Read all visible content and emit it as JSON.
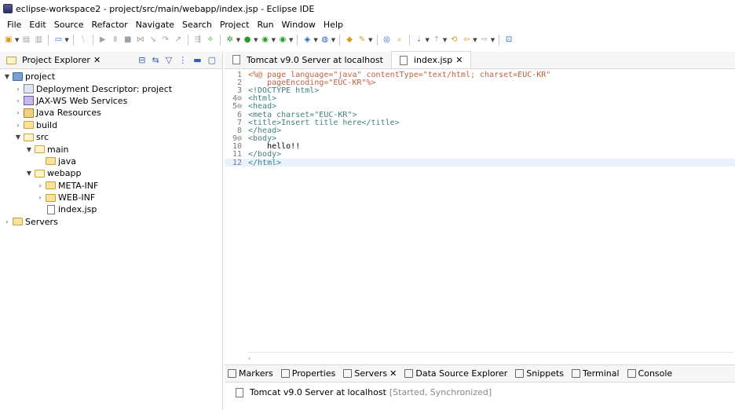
{
  "window": {
    "title": "eclipse-workspace2 - project/src/main/webapp/index.jsp - Eclipse IDE"
  },
  "menu": [
    "File",
    "Edit",
    "Source",
    "Refactor",
    "Navigate",
    "Search",
    "Project",
    "Run",
    "Window",
    "Help"
  ],
  "explorer": {
    "tab_label": "Project Explorer",
    "tree": [
      {
        "label": "project",
        "depth": 0,
        "expanded": true,
        "icon": "project-icon"
      },
      {
        "label": "Deployment Descriptor: project",
        "depth": 1,
        "expanded": false,
        "icon": "descriptor-icon"
      },
      {
        "label": "JAX-WS Web Services",
        "depth": 1,
        "expanded": false,
        "icon": "webservice-icon"
      },
      {
        "label": "Java Resources",
        "depth": 1,
        "expanded": false,
        "icon": "java-resources-icon"
      },
      {
        "label": "build",
        "depth": 1,
        "expanded": false,
        "icon": "folder-icon"
      },
      {
        "label": "src",
        "depth": 1,
        "expanded": true,
        "icon": "folder-icon"
      },
      {
        "label": "main",
        "depth": 2,
        "expanded": true,
        "icon": "folder-icon"
      },
      {
        "label": "java",
        "depth": 3,
        "expanded": null,
        "icon": "folder-icon"
      },
      {
        "label": "webapp",
        "depth": 2,
        "expanded": true,
        "icon": "folder-icon"
      },
      {
        "label": "META-INF",
        "depth": 3,
        "expanded": false,
        "icon": "folder-icon"
      },
      {
        "label": "WEB-INF",
        "depth": 3,
        "expanded": false,
        "icon": "folder-icon"
      },
      {
        "label": "index.jsp",
        "depth": 3,
        "expanded": null,
        "icon": "file-icon"
      },
      {
        "label": "Servers",
        "depth": 0,
        "expanded": false,
        "icon": "folder-icon"
      }
    ]
  },
  "editor": {
    "tabs": [
      {
        "label": "Tomcat v9.0 Server at localhost",
        "active": false
      },
      {
        "label": "index.jsp",
        "active": true
      }
    ],
    "lines": [
      {
        "n": "1",
        "text": "<%@ page language=\"java\" contentType=\"text/html; charset=EUC-KR\""
      },
      {
        "n": "2",
        "text": "    pageEncoding=\"EUC-KR\"%>"
      },
      {
        "n": "3",
        "text": "<!DOCTYPE html>"
      },
      {
        "n": "4⊖",
        "text": "<html>"
      },
      {
        "n": "5⊖",
        "text": "<head>"
      },
      {
        "n": "6",
        "text": "<meta charset=\"EUC-KR\">"
      },
      {
        "n": "7",
        "text": "<title>Insert title here</title>"
      },
      {
        "n": "8",
        "text": "</head>"
      },
      {
        "n": "9⊖",
        "text": "<body>"
      },
      {
        "n": "10",
        "text": "    hello!!"
      },
      {
        "n": "11",
        "text": "</body>"
      },
      {
        "n": "12",
        "text": "</html>"
      }
    ]
  },
  "panel": {
    "tabs": [
      "Markers",
      "Properties",
      "Servers",
      "Data Source Explorer",
      "Snippets",
      "Terminal",
      "Console"
    ],
    "server_name": "Tomcat v9.0 Server at localhost",
    "server_status": "[Started, Synchronized]"
  }
}
